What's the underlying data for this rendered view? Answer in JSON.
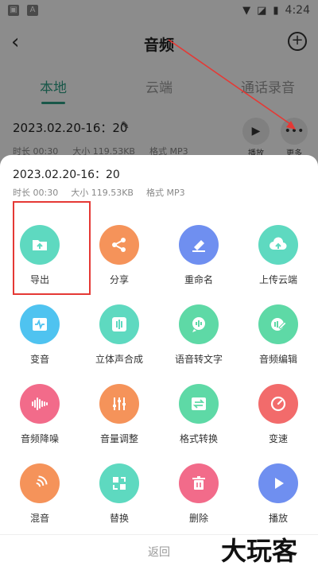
{
  "status_bar": {
    "time": "4:24"
  },
  "header": {
    "title": "音频"
  },
  "tabs": [
    {
      "label": "本地",
      "active": true
    },
    {
      "label": "云端",
      "active": false
    },
    {
      "label": "通话录音",
      "active": false
    }
  ],
  "recording": {
    "title": "2023.02.20-16：20",
    "duration": "时长 00:30",
    "size": "大小 119.53KB",
    "format": "格式 MP3",
    "play_label": "播放",
    "more_label": "更多"
  },
  "sheet": {
    "title": "2023.02.20-16：20",
    "duration": "时长 00:30",
    "size": "大小 119.53KB",
    "format": "格式 MP3",
    "actions": [
      {
        "label": "导出",
        "icon": "folder-export-icon",
        "color": "#5ed9c0"
      },
      {
        "label": "分享",
        "icon": "share-icon",
        "color": "#f5935a"
      },
      {
        "label": "重命名",
        "icon": "eraser-icon",
        "color": "#6f8ff0"
      },
      {
        "label": "上传云端",
        "icon": "cloud-upload-icon",
        "color": "#5ed9c0"
      },
      {
        "label": "变音",
        "icon": "waveform-box-icon",
        "color": "#4fc3f0"
      },
      {
        "label": "立体声合成",
        "icon": "stereo-icon",
        "color": "#5ed9c0"
      },
      {
        "label": "语音转文字",
        "icon": "speech-text-icon",
        "color": "#5ed9a6"
      },
      {
        "label": "音频编辑",
        "icon": "audio-edit-icon",
        "color": "#5ed9a6"
      },
      {
        "label": "音频降噪",
        "icon": "noise-reduction-icon",
        "color": "#f26b8a"
      },
      {
        "label": "音量调整",
        "icon": "equalizer-icon",
        "color": "#f5935a"
      },
      {
        "label": "格式转换",
        "icon": "format-convert-icon",
        "color": "#5ed9a6"
      },
      {
        "label": "变速",
        "icon": "speed-icon",
        "color": "#f26b6b"
      },
      {
        "label": "混音",
        "icon": "mix-icon",
        "color": "#f5935a"
      },
      {
        "label": "替换",
        "icon": "replace-icon",
        "color": "#5ed9c0"
      },
      {
        "label": "删除",
        "icon": "trash-icon",
        "color": "#f26b8a"
      },
      {
        "label": "播放",
        "icon": "play-icon",
        "color": "#6f8ff0"
      }
    ],
    "return_label": "返回"
  },
  "watermark": "大玩客"
}
